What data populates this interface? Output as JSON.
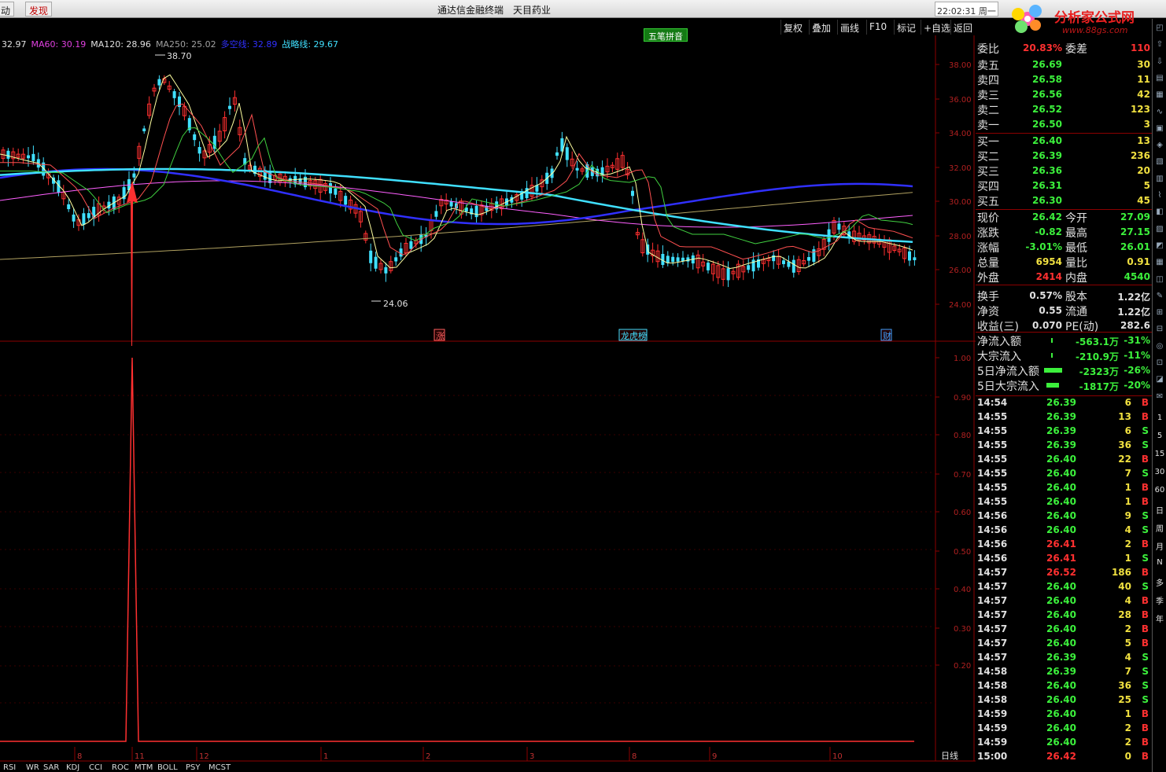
{
  "menu": {
    "item0": "动",
    "item1": "发现"
  },
  "window_title": "通达信金融终端",
  "stock_name": "天目药业",
  "clock": "22:02:31 周一",
  "logo": {
    "text": "分析家公式网",
    "url": "www.88gs.com"
  },
  "toolbar": [
    "复权",
    "叠加",
    "画线",
    "F10",
    "标记",
    "+自选",
    "返回"
  ],
  "wubi_label": "五笔拼音",
  "indicators": [
    {
      "label": "32.97",
      "color": "#e0e0e0"
    },
    {
      "label": "MA60: 30.19",
      "color": "#e040e0"
    },
    {
      "label": "MA120: 28.96",
      "color": "#e0e0e0"
    },
    {
      "label": "MA250: 25.02",
      "color": "#a0a0a0"
    },
    {
      "label": "多空线: 32.89",
      "color": "#3030ff"
    },
    {
      "label": "战略线: 29.67",
      "color": "#40e0ff"
    }
  ],
  "price_axis": [
    "38.00",
    "36.00",
    "34.00",
    "32.00",
    "30.00",
    "28.00",
    "26.00",
    "24.00"
  ],
  "vol_axis": [
    "1.00",
    "0.90",
    "0.80",
    "0.70",
    "0.60",
    "0.50",
    "0.40",
    "0.30",
    "0.20"
  ],
  "high_label": "38.70",
  "low_label": "24.06",
  "markers": [
    "涨",
    "龙虎榜",
    "财"
  ],
  "date_ticks": [
    "8",
    "11",
    "12",
    "1",
    "2",
    "3",
    "8",
    "9",
    "10"
  ],
  "bottom_tabs": [
    "RSI",
    "WR",
    "SAR",
    "KDJ",
    "CCI",
    "ROC",
    "MTM",
    "BOLL",
    "PSY",
    "MCST"
  ],
  "period_label": "日线",
  "quote": {
    "weibi_label": "委比",
    "weibi": "20.83%",
    "weicha_label": "委差",
    "weicha": "110",
    "asks": [
      {
        "label": "卖五",
        "price": "26.69",
        "vol": "30"
      },
      {
        "label": "卖四",
        "price": "26.58",
        "vol": "11"
      },
      {
        "label": "卖三",
        "price": "26.56",
        "vol": "42"
      },
      {
        "label": "卖二",
        "price": "26.52",
        "vol": "123"
      },
      {
        "label": "卖一",
        "price": "26.50",
        "vol": "3"
      }
    ],
    "bids": [
      {
        "label": "买一",
        "price": "26.40",
        "vol": "13"
      },
      {
        "label": "买二",
        "price": "26.39",
        "vol": "236"
      },
      {
        "label": "买三",
        "price": "26.36",
        "vol": "20"
      },
      {
        "label": "买四",
        "price": "26.31",
        "vol": "5"
      },
      {
        "label": "买五",
        "price": "26.30",
        "vol": "45"
      }
    ],
    "stats": [
      {
        "l1": "现价",
        "v1": "26.42",
        "c1": "#3cf03c",
        "l2": "今开",
        "v2": "27.09",
        "c2": "#3cf03c"
      },
      {
        "l1": "涨跌",
        "v1": "-0.82",
        "c1": "#3cf03c",
        "l2": "最高",
        "v2": "27.15",
        "c2": "#3cf03c"
      },
      {
        "l1": "涨幅",
        "v1": "-3.01%",
        "c1": "#3cf03c",
        "l2": "最低",
        "v2": "26.01",
        "c2": "#3cf03c"
      },
      {
        "l1": "总量",
        "v1": "6954",
        "c1": "#f0e040",
        "l2": "量比",
        "v2": "0.91",
        "c2": "#f0e040"
      },
      {
        "l1": "外盘",
        "v1": "2414",
        "c1": "#ff3030",
        "l2": "内盘",
        "v2": "4540",
        "c2": "#3cf03c"
      },
      {
        "l1": "换手",
        "v1": "0.57%",
        "c1": "#e0e0e0",
        "l2": "股本",
        "v2": "1.22亿",
        "c2": "#e0e0e0"
      },
      {
        "l1": "净资",
        "v1": "0.55",
        "c1": "#e0e0e0",
        "l2": "流通",
        "v2": "1.22亿",
        "c2": "#e0e0e0"
      },
      {
        "l1": "收益(三)",
        "v1": "0.070",
        "c1": "#e0e0e0",
        "l2": "PE(动)",
        "v2": "282.6",
        "c2": "#e0e0e0"
      }
    ],
    "flows": [
      {
        "label": "净流入额",
        "amount": "-563.1万",
        "pct": "-31%",
        "bar": 0.05
      },
      {
        "label": "大宗流入",
        "amount": "-210.9万",
        "pct": "-11%",
        "bar": 0.02
      },
      {
        "label": "5日净流入额",
        "amount": "-2323万",
        "pct": "-26%",
        "bar": 0.9
      },
      {
        "label": "5日大宗流入",
        "amount": "-1817万",
        "pct": "-20%",
        "bar": 0.6
      }
    ]
  },
  "ticks": [
    {
      "t": "14:54",
      "p": "26.39",
      "v": "6",
      "s": "B"
    },
    {
      "t": "14:55",
      "p": "26.39",
      "v": "13",
      "s": "B"
    },
    {
      "t": "14:55",
      "p": "26.39",
      "v": "6",
      "s": "S"
    },
    {
      "t": "14:55",
      "p": "26.39",
      "v": "36",
      "s": "S"
    },
    {
      "t": "14:55",
      "p": "26.40",
      "v": "22",
      "s": "B"
    },
    {
      "t": "14:55",
      "p": "26.40",
      "v": "7",
      "s": "S"
    },
    {
      "t": "14:55",
      "p": "26.40",
      "v": "1",
      "s": "B"
    },
    {
      "t": "14:55",
      "p": "26.40",
      "v": "1",
      "s": "B"
    },
    {
      "t": "14:56",
      "p": "26.40",
      "v": "9",
      "s": "S"
    },
    {
      "t": "14:56",
      "p": "26.40",
      "v": "4",
      "s": "S"
    },
    {
      "t": "14:56",
      "p": "26.41",
      "v": "2",
      "s": "B"
    },
    {
      "t": "14:56",
      "p": "26.41",
      "v": "1",
      "s": "S"
    },
    {
      "t": "14:57",
      "p": "26.52",
      "v": "186",
      "s": "B"
    },
    {
      "t": "14:57",
      "p": "26.40",
      "v": "40",
      "s": "S"
    },
    {
      "t": "14:57",
      "p": "26.40",
      "v": "4",
      "s": "B"
    },
    {
      "t": "14:57",
      "p": "26.40",
      "v": "28",
      "s": "B"
    },
    {
      "t": "14:57",
      "p": "26.40",
      "v": "2",
      "s": "B"
    },
    {
      "t": "14:57",
      "p": "26.40",
      "v": "5",
      "s": "B"
    },
    {
      "t": "14:57",
      "p": "26.39",
      "v": "4",
      "s": "S"
    },
    {
      "t": "14:58",
      "p": "26.39",
      "v": "7",
      "s": "S"
    },
    {
      "t": "14:58",
      "p": "26.40",
      "v": "36",
      "s": "S"
    },
    {
      "t": "14:58",
      "p": "26.40",
      "v": "25",
      "s": "S"
    },
    {
      "t": "14:59",
      "p": "26.40",
      "v": "1",
      "s": "B"
    },
    {
      "t": "14:59",
      "p": "26.40",
      "v": "2",
      "s": "B"
    },
    {
      "t": "14:59",
      "p": "26.40",
      "v": "2",
      "s": "B"
    },
    {
      "t": "15:00",
      "p": "26.42",
      "v": "0",
      "s": "B"
    }
  ],
  "side_tools": [
    "1",
    "5",
    "15",
    "30",
    "60",
    "日",
    "周",
    "月",
    "N",
    "多",
    "季",
    "年"
  ],
  "colors": {
    "up": "#ff3030",
    "down": "#40e0ff",
    "green": "#3cf03c",
    "grid": "#8b0000",
    "yellow": "#f0e040"
  }
}
